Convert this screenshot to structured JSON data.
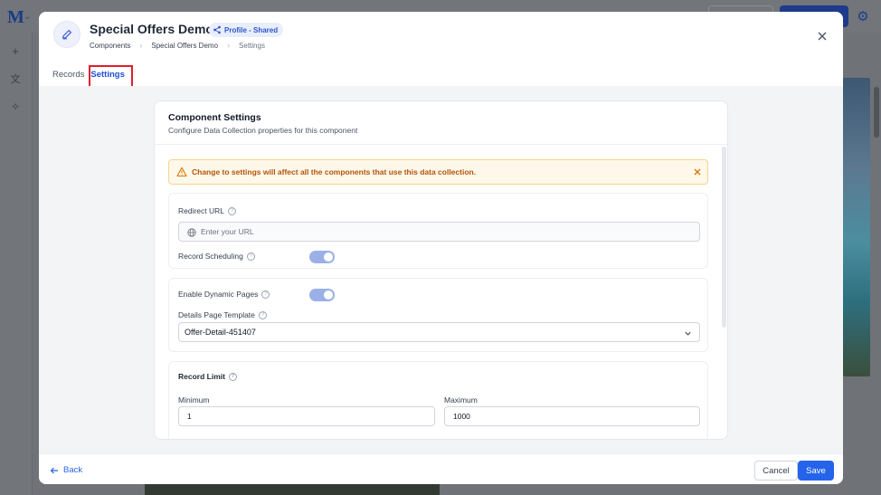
{
  "background": {
    "logo": "M",
    "left_icons": [
      "plus-icon",
      "translate-icon",
      "sparkle-icon"
    ]
  },
  "modal": {
    "title": "Special Offers Demo",
    "badge": "Profile - Shared",
    "breadcrumb": [
      "Components",
      "Special Offers Demo",
      "Settings"
    ],
    "tabs": [
      {
        "label": "Records",
        "active": false
      },
      {
        "label": "Settings",
        "active": true
      }
    ]
  },
  "settings": {
    "title": "Component Settings",
    "subtitle": "Configure Data Collection properties for this component",
    "alert": "Change to settings will affect all the components that use this data collection.",
    "redirect_url": {
      "label": "Redirect URL",
      "value": "",
      "placeholder": "Enter your URL"
    },
    "record_scheduling": {
      "label": "Record Scheduling",
      "enabled": true
    },
    "dynamic_pages": {
      "label": "Enable Dynamic Pages",
      "enabled": true
    },
    "details_template": {
      "label": "Details Page Template",
      "selected": "Offer-Detail-451407"
    },
    "record_limit": {
      "label": "Record Limit",
      "min_label": "Minimum",
      "min_value": "1",
      "max_label": "Maximum",
      "max_value": "1000"
    }
  },
  "footer": {
    "back_label": "Back",
    "cancel_label": "Cancel",
    "save_label": "Save"
  },
  "colors": {
    "accent": "#2563eb",
    "alert_text": "#b45309",
    "alert_bg": "#fef8ea",
    "highlight": "#e11d2e"
  }
}
